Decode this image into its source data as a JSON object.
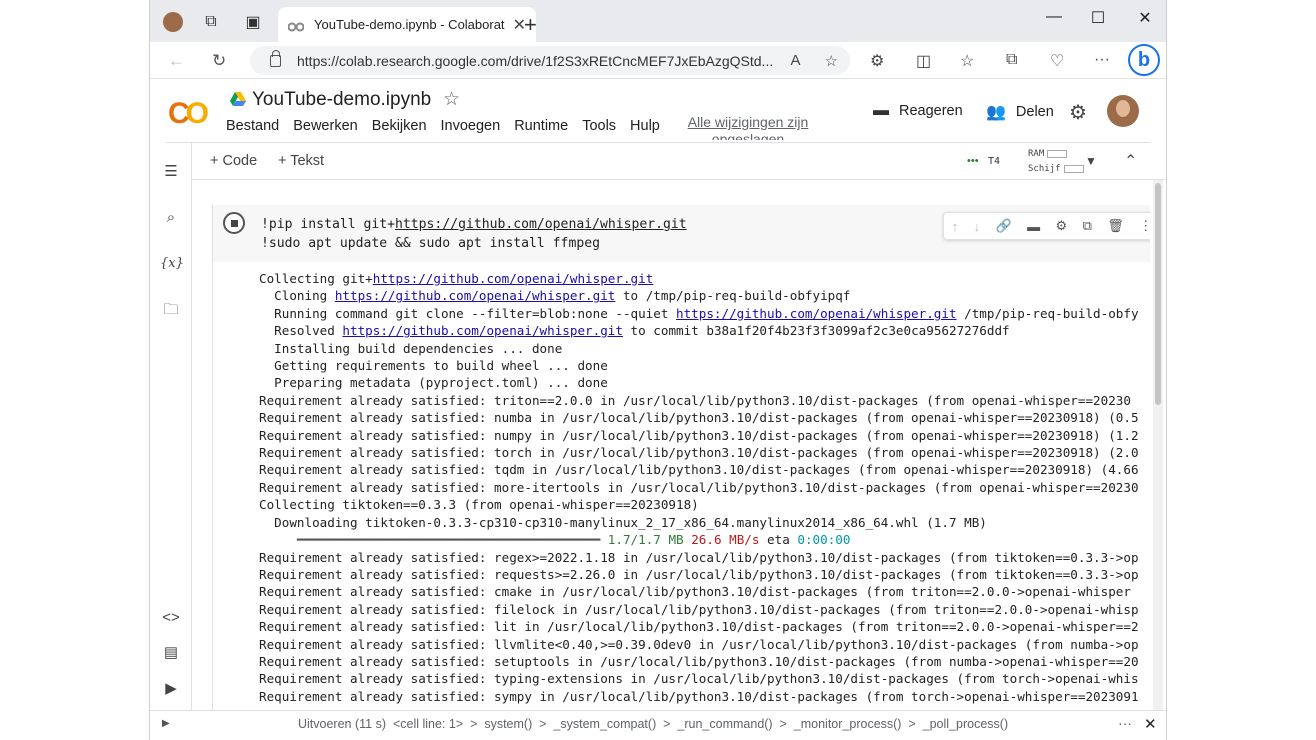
{
  "browser": {
    "tab_title": "YouTube-demo.ipynb - Colaborat",
    "url": "https://colab.research.google.com/drive/1f2S3xREtCncMEF7JxEbAzgQStd...",
    "bing_label": "b"
  },
  "colab": {
    "logo_a": "C",
    "logo_b": "O",
    "file_name": "YouTube-demo.ipynb",
    "menu": [
      "Bestand",
      "Bewerken",
      "Bekijken",
      "Invoegen",
      "Runtime",
      "Tools",
      "Hulp"
    ],
    "saved_status": "Alle wijzigingen zijn opgeslagen",
    "comment_label": "Reageren",
    "share_label": "Delen",
    "add_code": "+ Code",
    "add_text": "+ Tekst",
    "runtime": "T4",
    "ram_label": "RAM",
    "disk_label": "Schijf"
  },
  "cell": {
    "code_line1_prefix": "!pip install git+",
    "code_line1_link": "https://github.com/openai/whisper.git",
    "code_line2": "!sudo apt update && sudo apt install ffmpeg"
  },
  "output": {
    "l1a": "Collecting git+",
    "link": "https://github.com/openai/whisper.git",
    "l2a": "  Cloning ",
    "l2b": " to /tmp/pip-req-build-obfyipqf",
    "l3a": "  Running command git clone --filter=blob:none --quiet ",
    "l3b": " /tmp/pip-req-build-obfy",
    "l4a": "  Resolved ",
    "l4b": " to commit b38a1f20f4b23f3f3099af2c3e0ca95627276ddf",
    "l5": "  Installing build dependencies ... done",
    "l6": "  Getting requirements to build wheel ... done",
    "l7": "  Preparing metadata (pyproject.toml) ... done",
    "l8": "Requirement already satisfied: triton==2.0.0 in /usr/local/lib/python3.10/dist-packages (from openai-whisper==20230",
    "l9": "Requirement already satisfied: numba in /usr/local/lib/python3.10/dist-packages (from openai-whisper==20230918) (0.5",
    "l10": "Requirement already satisfied: numpy in /usr/local/lib/python3.10/dist-packages (from openai-whisper==20230918) (1.2",
    "l11": "Requirement already satisfied: torch in /usr/local/lib/python3.10/dist-packages (from openai-whisper==20230918) (2.0",
    "l12": "Requirement already satisfied: tqdm in /usr/local/lib/python3.10/dist-packages (from openai-whisper==20230918) (4.66",
    "l13": "Requirement already satisfied: more-itertools in /usr/local/lib/python3.10/dist-packages (from openai-whisper==20230",
    "l14": "Collecting tiktoken==0.3.3 (from openai-whisper==20230918)",
    "l15": "  Downloading tiktoken-0.3.3-cp310-cp310-manylinux_2_17_x86_64.manylinux2014_x86_64.whl (1.7 MB)",
    "pb_bar": "     ━━━━━━━━━━━━━━━━━━━━━━━━━━━━━━━━━━━━━━━━ ",
    "pb_size": "1.7/1.7 MB",
    "pb_speed": "26.6 MB/s",
    "pb_eta_label": " eta ",
    "pb_eta": "0:00:00",
    "l17": "Requirement already satisfied: regex>=2022.1.18 in /usr/local/lib/python3.10/dist-packages (from tiktoken==0.3.3->op",
    "l18": "Requirement already satisfied: requests>=2.26.0 in /usr/local/lib/python3.10/dist-packages (from tiktoken==0.3.3->op",
    "l19": "Requirement already satisfied: cmake in /usr/local/lib/python3.10/dist-packages (from triton==2.0.0->openai-whisper",
    "l20": "Requirement already satisfied: filelock in /usr/local/lib/python3.10/dist-packages (from triton==2.0.0->openai-whisp",
    "l21": "Requirement already satisfied: lit in /usr/local/lib/python3.10/dist-packages (from triton==2.0.0->openai-whisper==2",
    "l22": "Requirement already satisfied: llvmlite<0.40,>=0.39.0dev0 in /usr/local/lib/python3.10/dist-packages (from numba->op",
    "l23": "Requirement already satisfied: setuptools in /usr/local/lib/python3.10/dist-packages (from numba->openai-whisper==20",
    "l24": "Requirement already satisfied: typing-extensions in /usr/local/lib/python3.10/dist-packages (from torch->openai-whis",
    "l25": "Requirement already satisfied: sympy in /usr/local/lib/python3.10/dist-packages (from torch->openai-whisper==2023091"
  },
  "status": {
    "text": "Uitvoeren (11 s)  <cell line: 1>  >  system()  >  _system_compat()  >  _run_command()  >  _monitor_process()  >  _poll_process()"
  }
}
